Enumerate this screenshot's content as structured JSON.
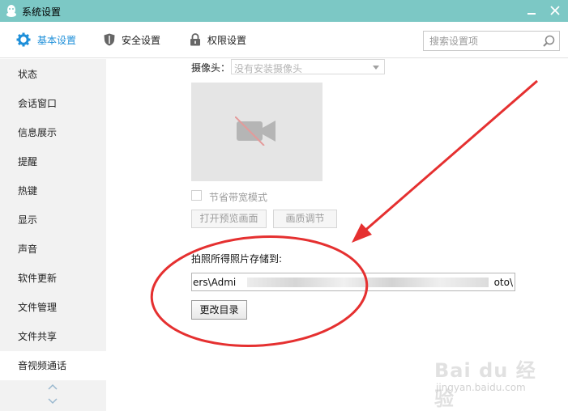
{
  "window": {
    "title": "系统设置"
  },
  "tabs": [
    {
      "label": "基本设置",
      "icon": "gear-icon",
      "active": true
    },
    {
      "label": "安全设置",
      "icon": "shield-icon",
      "active": false
    },
    {
      "label": "权限设置",
      "icon": "lock-icon",
      "active": false
    }
  ],
  "search": {
    "placeholder": "搜索设置项"
  },
  "sidebar": {
    "items": [
      {
        "label": "状态"
      },
      {
        "label": "会话窗口"
      },
      {
        "label": "信息展示"
      },
      {
        "label": "提醒"
      },
      {
        "label": "热键"
      },
      {
        "label": "显示"
      },
      {
        "label": "声音"
      },
      {
        "label": "软件更新"
      },
      {
        "label": "文件管理"
      },
      {
        "label": "文件共享"
      },
      {
        "label": "音视频通话",
        "active": true
      }
    ]
  },
  "camera": {
    "label": "摄像头：",
    "selected": "没有安装摄像头",
    "bandwidth_label": "节省带宽模式",
    "bandwidth_checked": false,
    "preview_button": "打开预览画面",
    "quality_button": "画质调节"
  },
  "photo": {
    "label": "拍照所得照片存储到:",
    "path_start": "ers\\Admi",
    "path_end": "oto\\",
    "change_button": "更改目录"
  },
  "watermark": {
    "line1": "Bai du 经验",
    "line2": "jingyan.baidu.com"
  },
  "colors": {
    "titlebar": "#7cc8c5",
    "active_tab": "#1e8fd9",
    "annotation": "#e53030"
  }
}
